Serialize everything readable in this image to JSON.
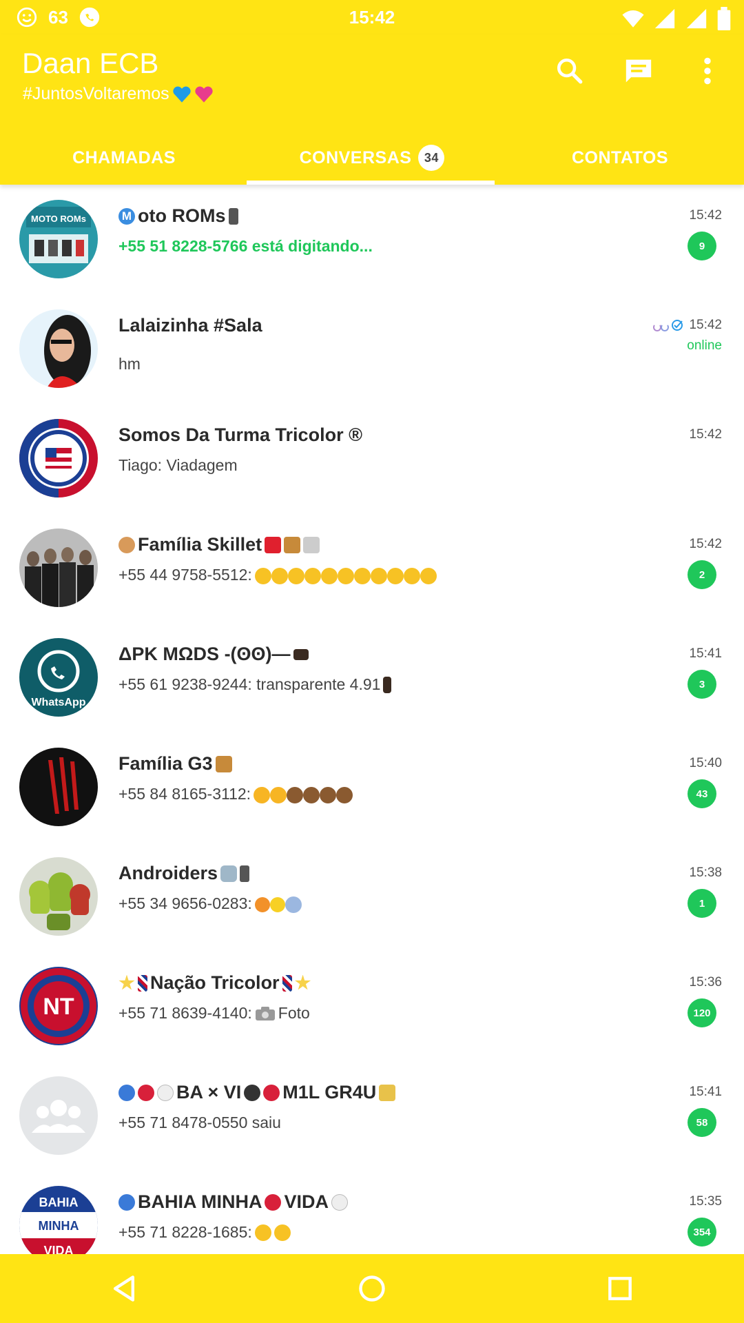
{
  "status_bar": {
    "time": "15:42",
    "notification_count": "63"
  },
  "header": {
    "title": "Daan ECB",
    "subtitle": "#JuntosVoltaremos",
    "actions": [
      "search-icon",
      "new-chat-icon",
      "more-vert-icon"
    ]
  },
  "tabs": [
    {
      "label": "CHAMADAS"
    },
    {
      "label": "CONVERSAS",
      "badge": "34",
      "active": true
    },
    {
      "label": "CONTATOS"
    }
  ],
  "chats": [
    {
      "name": "oto ROMs",
      "message": "+55 51 8228-5766 está digitando...",
      "time": "15:42",
      "unread": "9",
      "typing": true
    },
    {
      "name": "Lalaizinha #Sala",
      "message": "hm",
      "time": "15:42",
      "status": "online"
    },
    {
      "name": "Somos Da Turma Tricolor ®",
      "message": "Tiago: Viadagem",
      "time": "15:42"
    },
    {
      "name": "Família Skillet",
      "message": "+55 44 9758-5512:",
      "time": "15:42",
      "unread": "2"
    },
    {
      "name": "ΔPK MΩDS -(ʘʘ)—",
      "message": "+55 61 9238-9244: transparente 4.91",
      "time": "15:41",
      "unread": "3"
    },
    {
      "name": "Família G3",
      "message": "+55 84 8165-3112:",
      "time": "15:40",
      "unread": "43"
    },
    {
      "name": "Androiders",
      "message": "+55 34 9656-0283:",
      "time": "15:38",
      "unread": "1"
    },
    {
      "name": "Nação Tricolor",
      "message": "+55 71 8639-4140:",
      "message_suffix": "Foto",
      "time": "15:36",
      "unread": "120"
    },
    {
      "name": "BA × VI",
      "name_suffix": "M1L GR4U",
      "message": "+55 71 8478-0550 saiu",
      "time": "15:41",
      "unread": "58"
    },
    {
      "name": "BAHIA MINHA",
      "name_suffix": "VIDA",
      "message": "+55 71 8228-1685:",
      "time": "15:35",
      "unread": "354"
    }
  ],
  "avatars": {
    "moto_roms": "MOTO ROMs",
    "apk_mods": "WhatsApp",
    "nacao": "NT",
    "bahia": [
      "BAHIA",
      "MINHA",
      "VIDA"
    ]
  },
  "colors": {
    "accent": "#FFE414",
    "green": "#1FC75A"
  }
}
